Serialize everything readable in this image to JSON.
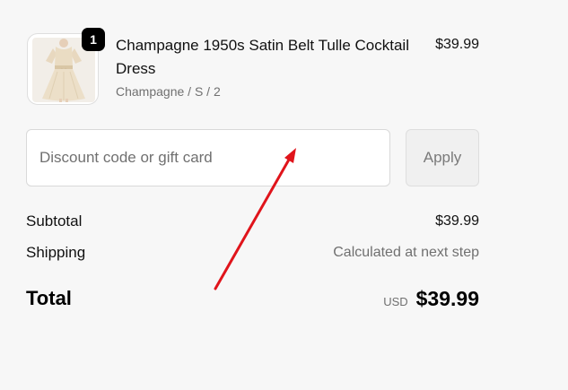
{
  "line_item": {
    "quantity": "1",
    "title": "Champagne 1950s Satin Belt Tulle Cocktail Dress",
    "variant": "Champagne / S / 2",
    "price": "$39.99",
    "image_icon": "dress-thumbnail"
  },
  "discount": {
    "placeholder": "Discount code or gift card",
    "value": "",
    "apply_label": "Apply"
  },
  "summary": {
    "subtotal_label": "Subtotal",
    "subtotal_value": "$39.99",
    "shipping_label": "Shipping",
    "shipping_value": "Calculated at next step",
    "total_label": "Total",
    "currency": "USD",
    "total_value": "$39.99"
  },
  "colors": {
    "background": "#f7f7f7",
    "annotation_arrow": "#e0141b",
    "badge": "#000000"
  }
}
